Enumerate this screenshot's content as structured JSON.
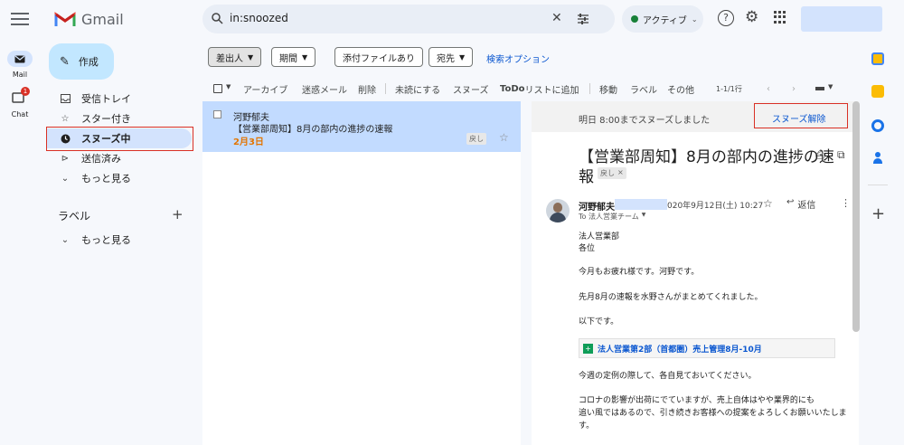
{
  "rail": {
    "mail_label": "Mail",
    "chat_label": "Chat",
    "chat_badge": "1"
  },
  "app": {
    "name": "Gmail"
  },
  "search": {
    "query": "in:snoozed"
  },
  "status": {
    "label": "アクティブ"
  },
  "nav": {
    "compose_label": "作成",
    "items": [
      {
        "label": "受信トレイ"
      },
      {
        "label": "スター付き"
      },
      {
        "label": "スヌーズ中"
      },
      {
        "label": "送信済み"
      },
      {
        "label": "もっと見る"
      }
    ],
    "labels_header": "ラベル",
    "labels_more": "もっと見る"
  },
  "filters": {
    "chips": [
      "差出人",
      "期間",
      "添付ファイルあり",
      "宛先"
    ],
    "search_options": "検索オプション"
  },
  "toolbar": {
    "archive": "アーカイブ",
    "spam": "迷惑メール",
    "delete": "削除",
    "mark_unread": "未読にする",
    "snooze": "スヌーズ",
    "todo": "ToDo",
    "todo_rest": "リストに追加",
    "move": "移動",
    "label": "ラベル",
    "more": "その他",
    "pagination": "1-1/1行"
  },
  "email_list": [
    {
      "sender": "河野郁夫",
      "subject": "【営業部周知】8月の部内の進捗の速報",
      "date": "2月3日",
      "tag": "戻し"
    }
  ],
  "reading": {
    "snooze_info": "明日 8:00までスヌーズしました",
    "unsnooze": "スヌーズ解除",
    "subject": "【営業部周知】8月の部内の進捗の速",
    "subject2": "報",
    "tag": "戻し",
    "tag_x": "×",
    "sender": "河野郁夫",
    "date": "020年9月12日(土) 10:27",
    "reply": "返信",
    "to": "To 法人営業チーム",
    "body": [
      "法人営業部",
      "各位",
      "今月もお疲れ様です。河野です。",
      "先月8月の速報を水野さんがまとめてくれました。",
      "以下です。"
    ],
    "attachment": "法人営業第2部（首都圏）売上管理8月-10月",
    "body2": [
      "今週の定例の際して、各自見ておいてください。",
      "コロナの影響が出荷にでていますが、売上自体はやや業界的にも",
      "追い風ではあるので、引き続きお客様への提案をよろしくお願いいたしま",
      "す。"
    ]
  },
  "colors": {
    "accent": "#0b57d0",
    "selected": "#c2dbff",
    "highlight": "#d93025",
    "date": "#e37400"
  }
}
